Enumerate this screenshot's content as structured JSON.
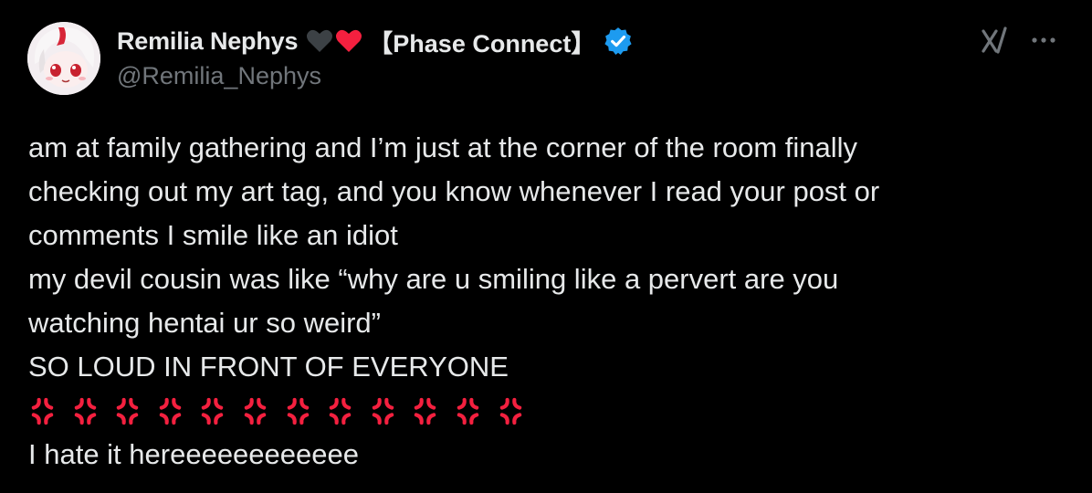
{
  "author": {
    "display_name": "Remilia Nephys",
    "affiliation_tag": "【Phase Connect】",
    "handle": "@Remilia_Nephys",
    "hearts": [
      "black-heart-icon",
      "red-heart-icon"
    ],
    "verified": true
  },
  "body": {
    "lines": [
      "am at family gathering and I’m just at the corner of the room finally",
      "checking out my art tag, and you know whenever I read your post or",
      "comments I smile like an idiot",
      "my devil cousin was like “why are u smiling like a pervert are you",
      "watching hentai ur so weird”",
      "SO LOUD IN FRONT OF EVERYONE"
    ],
    "anger_emoji_count": 12,
    "final_line": "I hate it hereeeeeeeeeeee"
  },
  "colors": {
    "background": "#000000",
    "text": "#e7e9ea",
    "secondary": "#71767b",
    "verified": "#1d9bf0",
    "anger": "#f4203f"
  }
}
